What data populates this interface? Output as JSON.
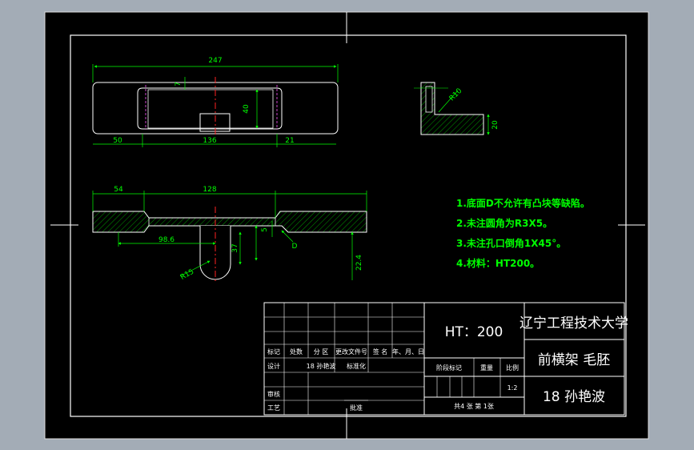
{
  "dims": {
    "top_length": "247",
    "top_left": "50",
    "top_mid": "136",
    "top_right": "21",
    "top_height": "40",
    "top_small": "7",
    "side_radius": "R10",
    "side_height": "20",
    "sec_left": "54",
    "sec_mid": "128",
    "sec_offset": "98.6",
    "sec_37": "37",
    "sec_5": "5",
    "sec_r15": "R15",
    "sec_224": "22.4",
    "sec_d": "D"
  },
  "notes": [
    "1.底面D不允许有凸块等缺陷。",
    "2.未注圆角为R3X5。",
    "3.未注孔口倒角1X45°。",
    "4.材料：HT200。"
  ],
  "title_block": {
    "rev_headers": [
      "标记",
      "处数",
      "分 区",
      "更改文件号",
      "签 名",
      "年、月、日"
    ],
    "design": "设计",
    "design_name": "18 孙艳波",
    "standardize": "标准化",
    "review": "审核",
    "process": "工艺",
    "approve": "批准",
    "stage": "阶段标记",
    "weight": "重量",
    "scale": "比例",
    "scale_value": "1:2",
    "sheets": "共4 张 第 1张",
    "material": "HT：200",
    "school": "辽宁工程技术大学",
    "part_name": "前横架 毛胚",
    "student": "18 孙艳波"
  }
}
